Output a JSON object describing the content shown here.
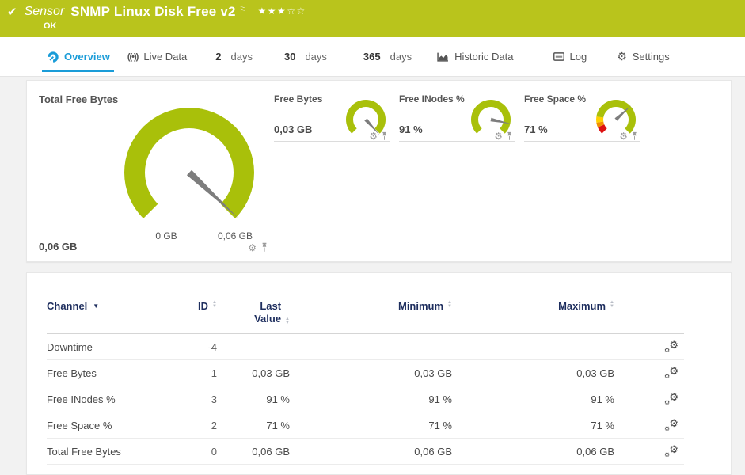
{
  "colors": {
    "brand_green": "#b9c41c",
    "gauge_green": "#a9c00a",
    "active_tab_blue": "#1a9cd8",
    "table_header_navy": "#1e2e5e",
    "alert_red": "#dd1111",
    "warn_orange": "#f08f00",
    "warn_yellow": "#ffd000"
  },
  "header": {
    "check_icon": "✔",
    "sensor_kind": "Sensor",
    "title": "SNMP Linux Disk Free v2",
    "flag_icon": "⚐",
    "rating_stars": "★★★☆☆",
    "status": "OK"
  },
  "tabs": [
    {
      "label": "Overview",
      "icon": "gauge-icon",
      "active": true
    },
    {
      "label": "Live Data",
      "icon": "broadcast-icon"
    },
    {
      "num": "2",
      "unit": "days"
    },
    {
      "num": "30",
      "unit": "days"
    },
    {
      "num": "365",
      "unit": "days"
    },
    {
      "label": "Historic Data",
      "icon": "area-chart-icon"
    },
    {
      "label": "Log",
      "icon": "log-icon"
    },
    {
      "label": "Settings",
      "icon": "gear-icon"
    }
  ],
  "panel_gauges": {
    "large": {
      "title": "Total Free Bytes",
      "value": "0,06 GB",
      "scale_min": "0 GB",
      "scale_max": "0,06 GB",
      "needle_bearing": 133,
      "segments": [
        {
          "from": 225,
          "to": 495,
          "color": "#a9c00a"
        }
      ]
    },
    "small": [
      {
        "title": "Free Bytes",
        "value": "0,03 GB",
        "needle_bearing": 138,
        "segments": [
          {
            "from": 225,
            "to": 495,
            "color": "#a9c00a"
          }
        ]
      },
      {
        "title": "Free INodes %",
        "value": "91 %",
        "needle_bearing": 102,
        "segments": [
          {
            "from": 225,
            "to": 495,
            "color": "#a9c00a"
          }
        ]
      },
      {
        "title": "Free Space %",
        "value": "71 %",
        "needle_bearing": 47,
        "segments": [
          {
            "from": 225,
            "to": 247,
            "color": "#dd1111"
          },
          {
            "from": 247,
            "to": 261,
            "color": "#f08f00"
          },
          {
            "from": 261,
            "to": 279,
            "color": "#ffd000"
          },
          {
            "from": 279,
            "to": 495,
            "color": "#a9c00a"
          }
        ]
      }
    ]
  },
  "table": {
    "columns": [
      "Channel",
      "ID",
      "Last Value",
      "Minimum",
      "Maximum"
    ],
    "rows": [
      {
        "channel": "Downtime",
        "id": "-4",
        "last": "",
        "min": "",
        "max": ""
      },
      {
        "channel": "Free Bytes",
        "id": "1",
        "last": "0,03 GB",
        "min": "0,03 GB",
        "max": "0,03 GB"
      },
      {
        "channel": "Free INodes %",
        "id": "3",
        "last": "91 %",
        "min": "91 %",
        "max": "91 %"
      },
      {
        "channel": "Free Space %",
        "id": "2",
        "last": "71 %",
        "min": "71 %",
        "max": "71 %"
      },
      {
        "channel": "Total Free Bytes",
        "id": "0",
        "last": "0,06 GB",
        "min": "0,06 GB",
        "max": "0,06 GB"
      }
    ]
  }
}
